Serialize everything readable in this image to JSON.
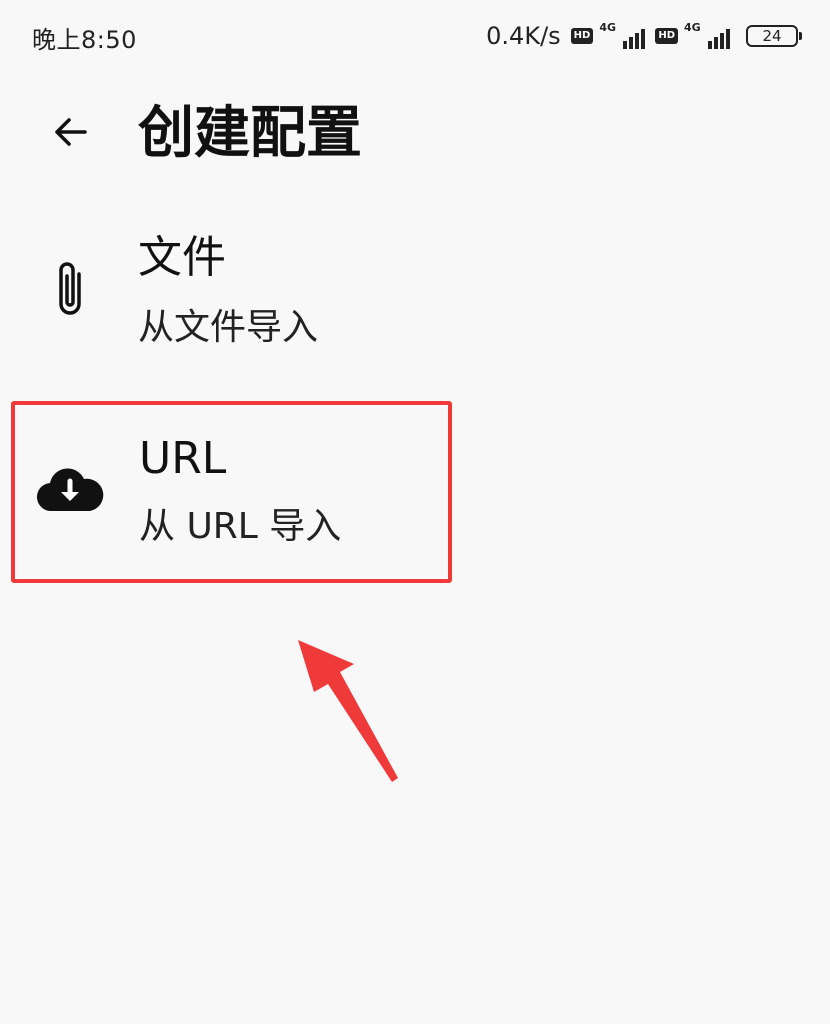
{
  "status_bar": {
    "time": "晚上8:50",
    "net_speed": "0.4K/s",
    "sim1": {
      "hd": "HD",
      "network": "4G"
    },
    "sim2": {
      "hd": "HD",
      "network": "4G"
    },
    "battery": "24"
  },
  "header": {
    "back_icon": "arrow-left-icon",
    "title": "创建配置"
  },
  "options": [
    {
      "icon": "paperclip-icon",
      "title": "文件",
      "subtitle": "从文件导入"
    },
    {
      "icon": "cloud-download-icon",
      "title": "URL",
      "subtitle": "从 URL 导入"
    }
  ],
  "colors": {
    "highlight": "#f03a3a",
    "background": "#f8f8f8",
    "text": "#111111"
  }
}
